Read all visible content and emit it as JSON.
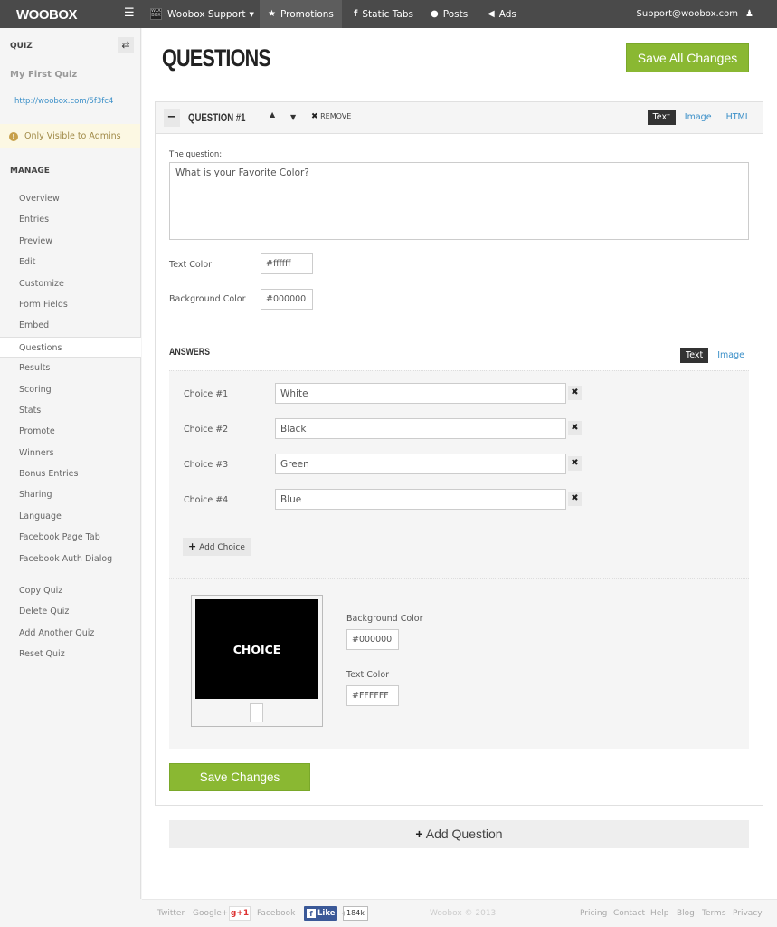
{
  "topnav": {
    "logo": "WOOBOX",
    "account": "Woobox Support",
    "account_icon_text": "WOO BOX",
    "tabs": [
      {
        "label": "Promotions",
        "icon": "star-icon",
        "glyph": "★",
        "active": true
      },
      {
        "label": "Static Tabs",
        "icon": "facebook-icon",
        "glyph": "f",
        "active": false
      },
      {
        "label": "Posts",
        "icon": "comment-icon",
        "glyph": "💬",
        "active": false
      },
      {
        "label": "Ads",
        "icon": "megaphone-icon",
        "glyph": "📢",
        "active": false
      }
    ],
    "user_email": "Support@woobox.com"
  },
  "sidebar": {
    "section_label": "QUIZ",
    "quiz_name": "My First Quiz",
    "quiz_url": "http://woobox.com/5f3fc4",
    "admin_notice": "Only Visible to Admins",
    "manage_label": "MANAGE",
    "items": [
      {
        "label": "Overview"
      },
      {
        "label": "Entries"
      },
      {
        "label": "Preview"
      },
      {
        "label": "Edit"
      },
      {
        "label": "Customize"
      },
      {
        "label": "Form Fields"
      },
      {
        "label": "Embed"
      },
      {
        "label": "Questions",
        "active": true
      },
      {
        "label": "Results"
      },
      {
        "label": "Scoring"
      },
      {
        "label": "Stats"
      },
      {
        "label": "Promote"
      },
      {
        "label": "Winners"
      },
      {
        "label": "Bonus Entries"
      },
      {
        "label": "Sharing"
      },
      {
        "label": "Language"
      },
      {
        "label": "Facebook Page Tab"
      },
      {
        "label": "Facebook Auth Dialog"
      }
    ],
    "actions": [
      {
        "label": "Copy Quiz"
      },
      {
        "label": "Delete Quiz"
      },
      {
        "label": "Add Another Quiz"
      },
      {
        "label": "Reset Quiz"
      }
    ]
  },
  "main": {
    "title": "QUESTIONS",
    "save_all_label": "Save All Changes",
    "question": {
      "title": "QUESTION #1",
      "remove_label": "REMOVE",
      "type_options": [
        "Text",
        "Image",
        "HTML"
      ],
      "type_selected": "Text",
      "question_label": "The question:",
      "question_text": "What is your Favorite Color?",
      "text_color_label": "Text Color",
      "text_color_value": "#ffffff",
      "bg_color_label": "Background Color",
      "bg_color_value": "#000000",
      "answers_title": "ANSWERS",
      "answer_type_options": [
        "Text",
        "Image"
      ],
      "answer_type_selected": "Text",
      "choices": [
        {
          "label": "Choice #1",
          "value": "White"
        },
        {
          "label": "Choice #2",
          "value": "Black"
        },
        {
          "label": "Choice #3",
          "value": "Green"
        },
        {
          "label": "Choice #4",
          "value": "Blue"
        }
      ],
      "add_choice_label": "Add Choice",
      "preview_text": "CHOICE",
      "choice_bg_label": "Background Color",
      "choice_bg_value": "#000000",
      "choice_text_label": "Text Color",
      "choice_text_value": "#FFFFFF",
      "save_label": "Save Changes"
    },
    "add_question_label": "Add Question"
  },
  "footer": {
    "links_left": [
      "Twitter",
      "Google+",
      "Facebook"
    ],
    "gplus_label": "g+1",
    "fb_like_label": "Like",
    "fb_like_count": "184k",
    "copyright": "Woobox © 2013",
    "links_right": [
      "Pricing",
      "Contact",
      "Help",
      "Blog",
      "Terms",
      "Privacy"
    ]
  },
  "colors": {
    "nav_bg": "#4a4a4a",
    "accent_green": "#8ab832",
    "link_blue": "#3a8fc8",
    "notice_bg": "#fcf8e3"
  }
}
